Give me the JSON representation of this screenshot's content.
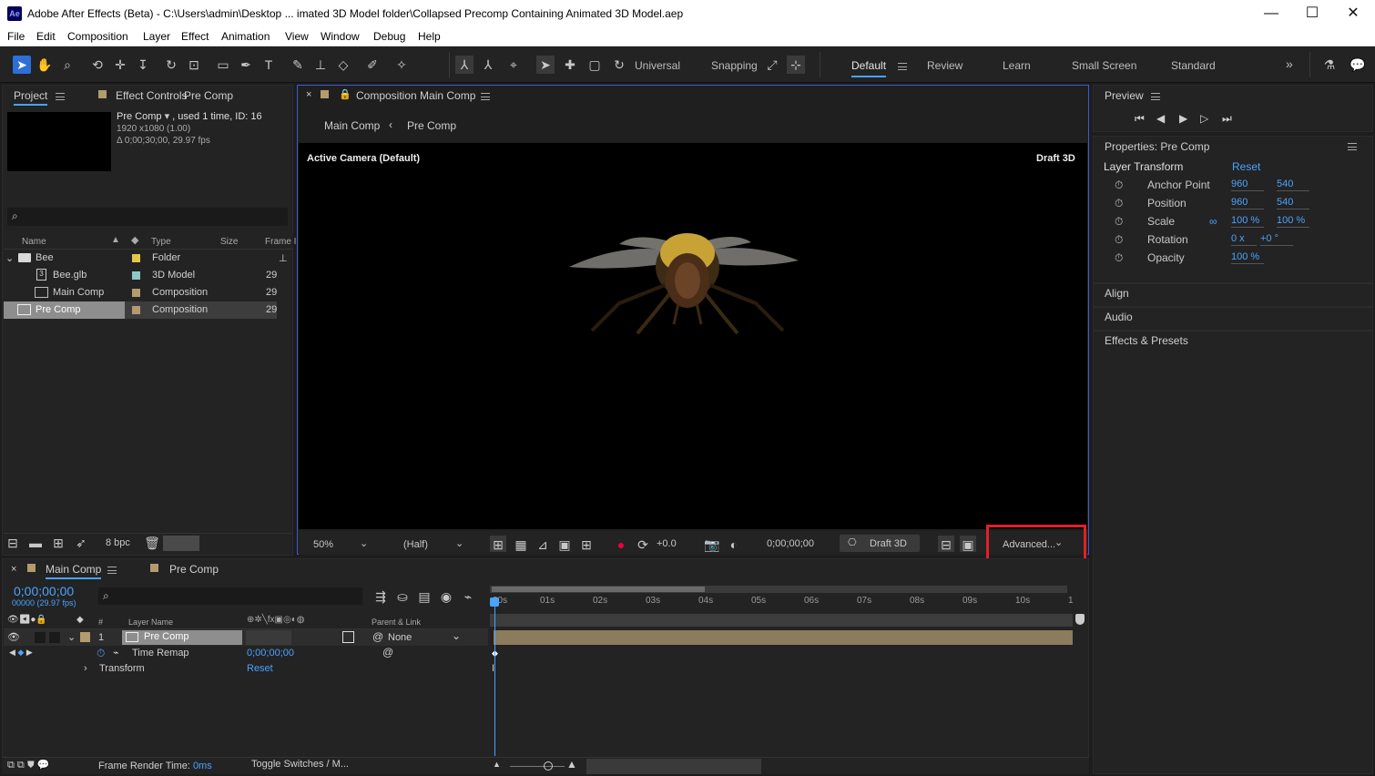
{
  "window": {
    "title": "Adobe After Effects (Beta) - C:\\Users\\admin\\Desktop ... imated 3D Model folder\\Collapsed Precomp Containing Animated 3D Model.aep",
    "logo": "Ae",
    "minimize": "—",
    "maximize": "☐",
    "close": "✕"
  },
  "menu": [
    "File",
    "Edit",
    "Composition",
    "Layer",
    "Effect",
    "Animation",
    "View",
    "Window",
    "Debug",
    "Help"
  ],
  "toolbar": {
    "universal": "Universal",
    "snapping": "Snapping",
    "workspaces": [
      "Default",
      "Review",
      "Learn",
      "Small Screen",
      "Standard"
    ],
    "more": "»"
  },
  "project": {
    "tab": "Project",
    "effect_tab": "Effect Controls",
    "effect_target": "Pre Comp",
    "item_name": "Pre Comp",
    "item_info": ", used 1 time, ID: 16",
    "dims": "1920 x1080 (1.00)",
    "duration": "Δ 0;00;30;00, 29.97 fps",
    "search_placeholder": "",
    "columns": {
      "name": "Name",
      "type": "Type",
      "size": "Size",
      "frame": "Frame I"
    },
    "rows": [
      {
        "name": "Bee",
        "type": "Folder",
        "size": "",
        "color": "#e3c84a",
        "icon": "folder-icon",
        "indent": 0
      },
      {
        "name": "Bee.glb",
        "type": "3D Model",
        "size": "29",
        "color": "#8ec7c7",
        "icon": "model-icon",
        "indent": 1
      },
      {
        "name": "Main Comp",
        "type": "Composition",
        "size": "29",
        "color": "#b39b6e",
        "icon": "comp-icon",
        "indent": 1
      },
      {
        "name": "Pre Comp",
        "type": "Composition",
        "size": "29",
        "color": "#b39b6e",
        "icon": "comp-icon",
        "indent": 0
      }
    ],
    "bpc": "8 bpc"
  },
  "comp": {
    "tab_label": "Composition",
    "tab_name": "Main Comp",
    "crumb1": "Main Comp",
    "crumb2": "Pre Comp",
    "camera": "Active Camera (Default)",
    "renderer": "Draft 3D",
    "zoom": "50%",
    "resolution": "(Half)",
    "exposure": "+0.0",
    "timecode": "0;00;00;00",
    "draft3d": "Draft 3D",
    "advanced": "Advanced..."
  },
  "preview": {
    "title": "Preview"
  },
  "properties": {
    "title": "Properties: Pre Comp",
    "section": "Layer Transform",
    "reset": "Reset",
    "items": [
      {
        "label": "Anchor Point",
        "v1": "960",
        "v2": "540"
      },
      {
        "label": "Position",
        "v1": "960",
        "v2": "540"
      },
      {
        "label": "Scale",
        "v1": "100 %",
        "v2": "100 %"
      },
      {
        "label": "Rotation",
        "v1": "0 x",
        "v2": "+0 °"
      },
      {
        "label": "Opacity",
        "v1": "100 %",
        "v2": ""
      }
    ],
    "panels": [
      "Align",
      "Audio",
      "Effects & Presets"
    ]
  },
  "timeline": {
    "tab1": "Main Comp",
    "tab2": "Pre Comp",
    "timecode": "0;00;00;00",
    "fps": "00000 (29.97 fps)",
    "col_hash": "#",
    "col_layer": "Layer Name",
    "col_parent": "Parent & Link",
    "layer_num": "1",
    "layer_name": "Pre Comp",
    "parent": "None",
    "time_remap": "Time Remap",
    "time_remap_val": "0;00;00;00",
    "transform": "Transform",
    "transform_reset": "Reset",
    "ticks": [
      "00s",
      "01s",
      "02s",
      "03s",
      "04s",
      "05s",
      "06s",
      "07s",
      "08s",
      "09s",
      "10s",
      "1"
    ],
    "footer_label": "Frame Render Time:",
    "footer_value": "0ms",
    "toggle": "Toggle Switches / M..."
  },
  "colors": {
    "accent": "#4aa3ff",
    "highlight_box": "#e0202a",
    "selected_tool": "#2d6fd6",
    "layer_bar": "#8c7b5c"
  }
}
